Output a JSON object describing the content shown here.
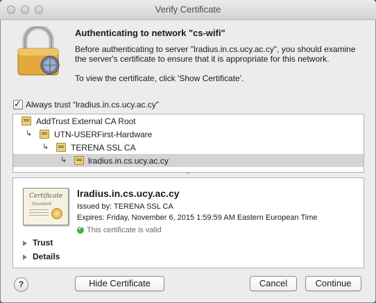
{
  "window": {
    "title": "Verify Certificate"
  },
  "header": {
    "heading": "Authenticating to network \"cs-wifi\"",
    "message_line1": "Before authenticating to server \"lradius.in.cs.ucy.ac.cy\", you should examine",
    "message_line2": "the server's certificate to ensure that it is appropriate for this network.",
    "instruction": "To view the certificate, click 'Show Certificate'."
  },
  "always_trust": {
    "checked": true,
    "label": "Always trust “lradius.in.cs.ucy.ac.cy”"
  },
  "chain": [
    {
      "label": "AddTrust External CA Root"
    },
    {
      "label": "UTN-USERFirst-Hardware"
    },
    {
      "label": "TERENA SSL CA"
    },
    {
      "label": "lradius.in.cs.ucy.ac.cy",
      "selected": true
    }
  ],
  "details": {
    "cert_image_title": "Certificate",
    "cert_image_subtitle": "Standard",
    "name": "lradius.in.cs.ucy.ac.cy",
    "issued_by": "Issued by: TERENA SSL CA",
    "expires": "Expires: Friday, November 6, 2015 1:59:59 AM Eastern European Time",
    "status": "This certificate is valid",
    "sections": [
      "Trust",
      "Details"
    ]
  },
  "buttons": {
    "help": "?",
    "hide_certificate": "Hide Certificate",
    "cancel": "Cancel",
    "continue": "Continue"
  },
  "colors": {
    "valid_green": "#3db04a",
    "selected_row": "#d4d4d4"
  }
}
